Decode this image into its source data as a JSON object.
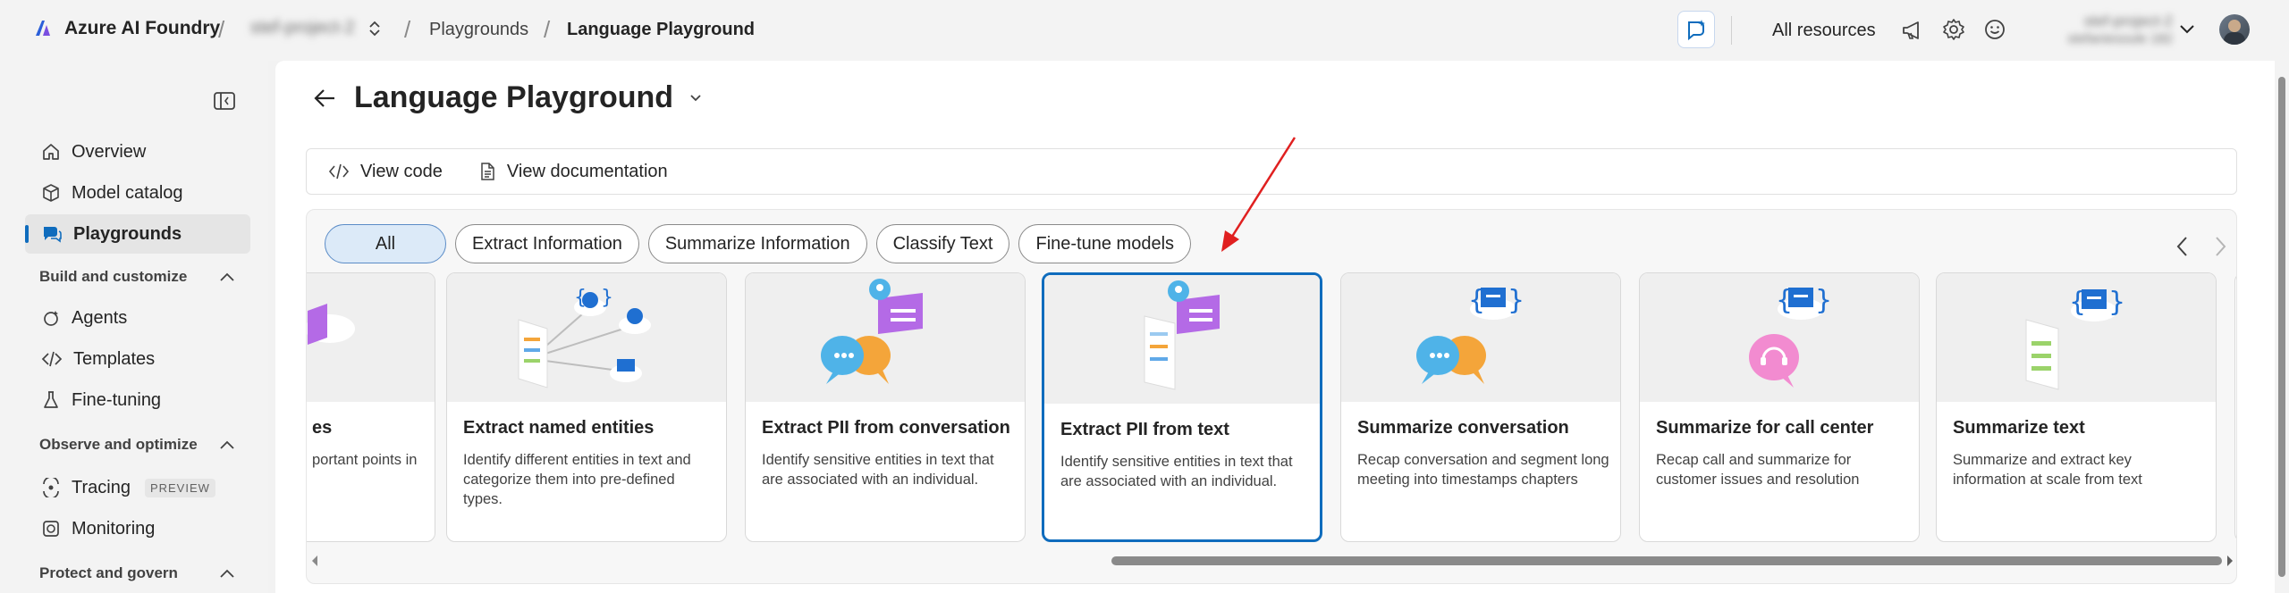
{
  "app": {
    "name": "Azure AI Foundry"
  },
  "breadcrumbs": {
    "project": "stef-project-2",
    "playgrounds": "Playgrounds",
    "current": "Language Playground"
  },
  "topbar": {
    "all_resources": "All resources",
    "account_line1": "stef-project-2",
    "account_line2": "stefaniesoule 182"
  },
  "sidebar": {
    "items_top": [
      {
        "label": "Overview",
        "icon": "home-icon"
      },
      {
        "label": "Model catalog",
        "icon": "cube-icon"
      },
      {
        "label": "Playgrounds",
        "icon": "chat-icon",
        "active": true
      }
    ],
    "section_build": "Build and customize",
    "items_build": [
      {
        "label": "Agents",
        "icon": "agents-icon"
      },
      {
        "label": "Templates",
        "icon": "code-icon"
      },
      {
        "label": "Fine-tuning",
        "icon": "flask-icon"
      }
    ],
    "section_observe": "Observe and optimize",
    "items_observe": [
      {
        "label": "Tracing",
        "icon": "tracing-icon",
        "badge": "PREVIEW"
      },
      {
        "label": "Monitoring",
        "icon": "monitor-icon"
      }
    ],
    "section_protect": "Protect and govern"
  },
  "page": {
    "title": "Language Playground"
  },
  "toolbar": {
    "view_code": "View code",
    "view_docs": "View documentation"
  },
  "filters": [
    "All",
    "Extract Information",
    "Summarize Information",
    "Classify Text",
    "Fine-tune models"
  ],
  "cards": [
    {
      "title": "es",
      "desc": "portant points in"
    },
    {
      "title": "Extract named entities",
      "desc": "Identify different entities in text and categorize them into pre-defined types."
    },
    {
      "title": "Extract PII from conversation",
      "desc": "Identify sensitive entities in text that are associated with an individual."
    },
    {
      "title": "Extract PII from text",
      "desc": "Identify sensitive entities in text that are associated with an individual."
    },
    {
      "title": "Summarize conversation",
      "desc": "Recap conversation and segment long meeting into timestamps chapters"
    },
    {
      "title": "Summarize for call center",
      "desc": "Recap call and summarize for customer issues and resolution"
    },
    {
      "title": "Summarize text",
      "desc": "Summarize and extract key information at scale from text"
    }
  ],
  "colors": {
    "accent": "#0f6cbd",
    "annotation_arrow": "#e02020"
  }
}
